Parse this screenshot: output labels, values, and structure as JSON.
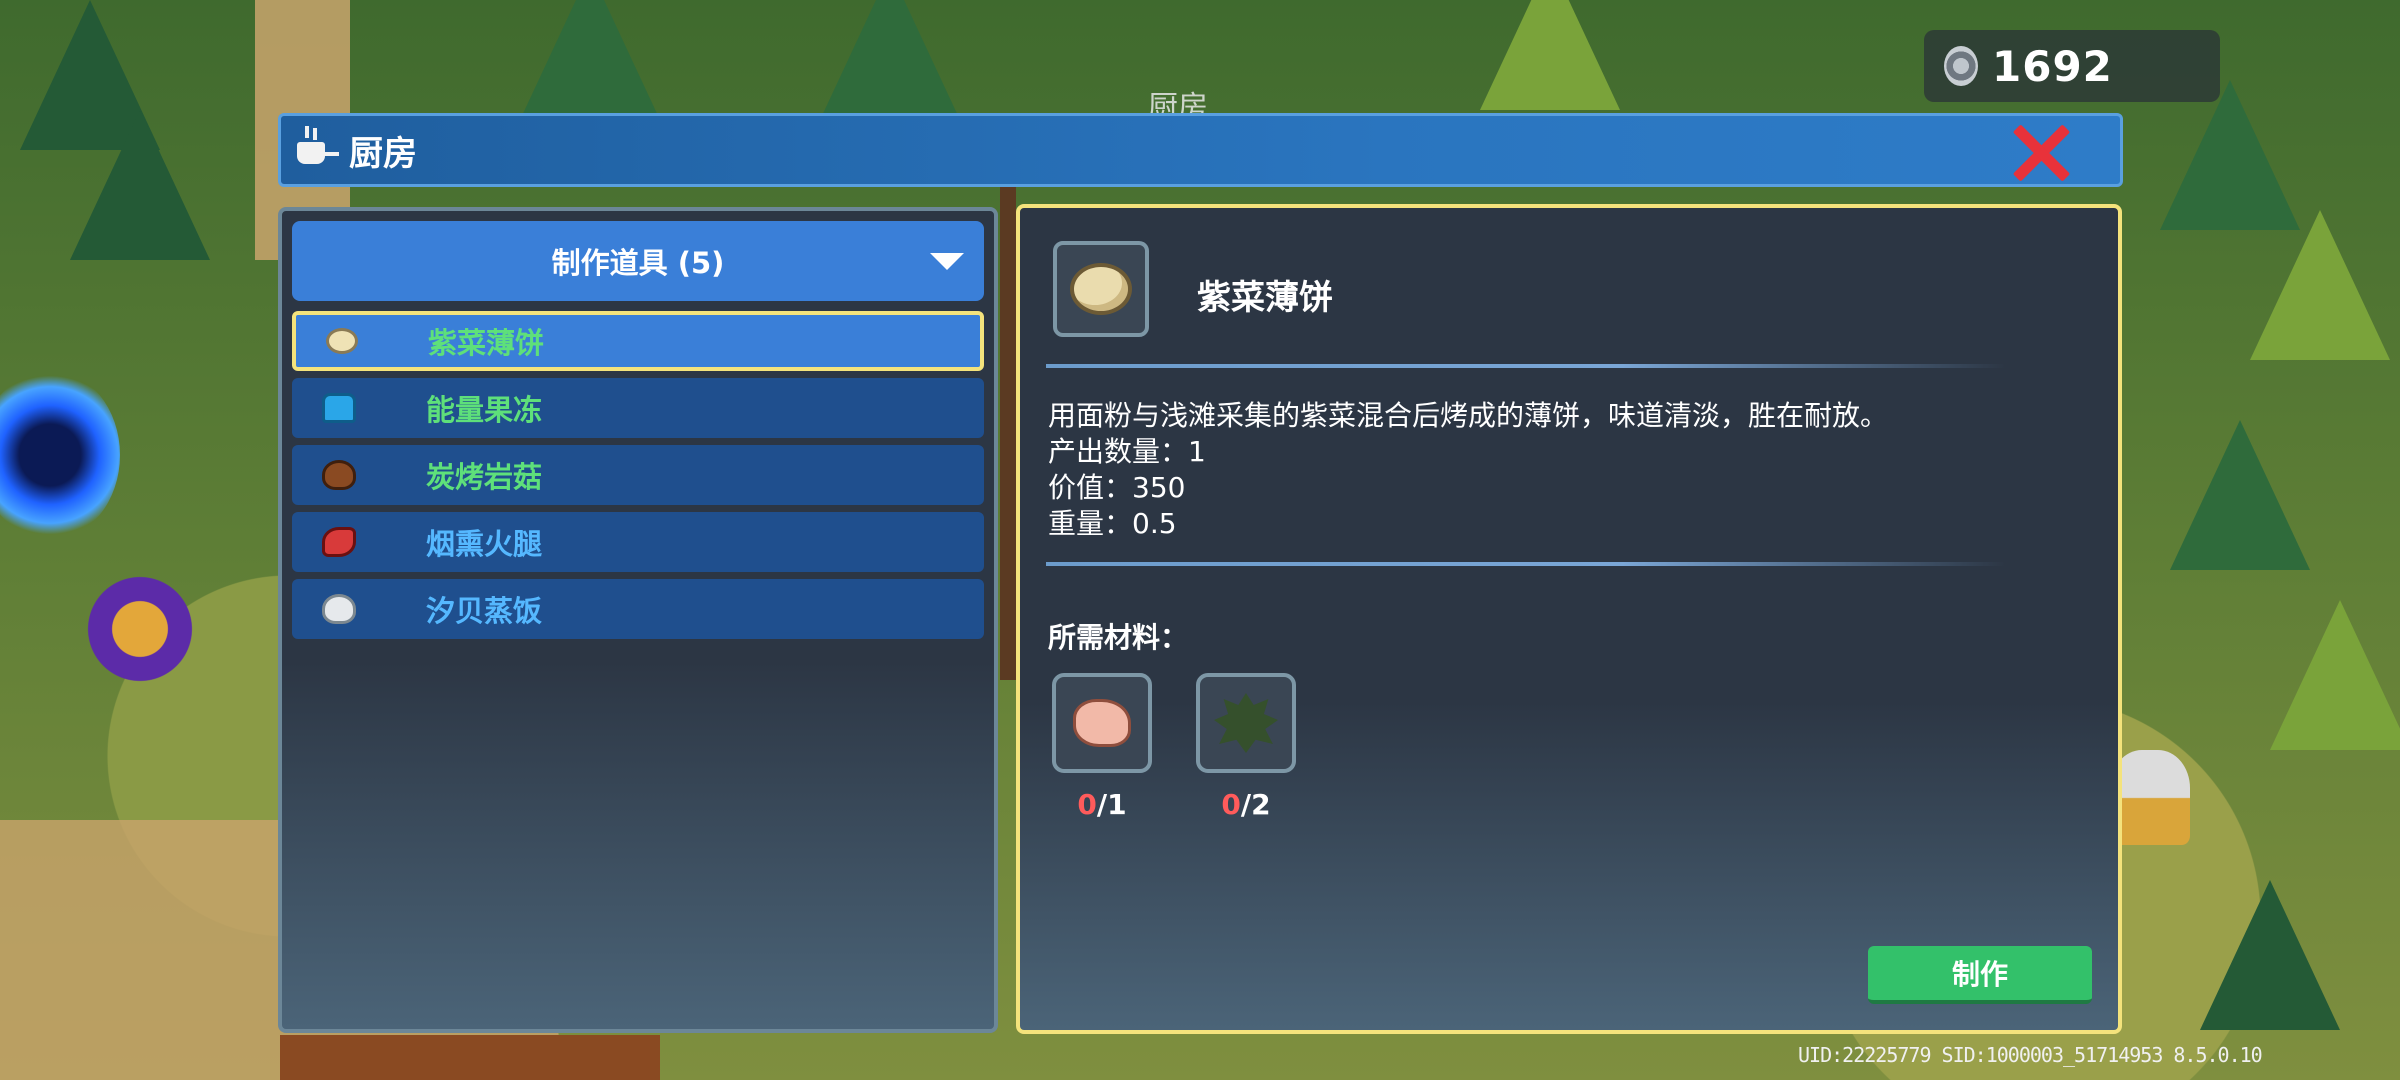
{
  "currency": {
    "icon": "coin-icon",
    "amount": "1692"
  },
  "background_label": "厨房",
  "window": {
    "icon": "cooking-pot-icon",
    "title": "厨房",
    "close_icon": "close-x-icon"
  },
  "category": {
    "label": "制作道具 (5)",
    "caret_icon": "triangle-down-icon"
  },
  "recipes": [
    {
      "name": "紫菜薄饼",
      "icon": "flatbread-icon",
      "selected": true,
      "color": "#5ee07a"
    },
    {
      "name": "能量果冻",
      "icon": "jelly-icon",
      "selected": false,
      "color": "#5ee07a"
    },
    {
      "name": "炭烤岩菇",
      "icon": "mushroom-icon",
      "selected": false,
      "color": "#5ee07a"
    },
    {
      "name": "烟熏火腿",
      "icon": "ham-icon",
      "selected": false,
      "color": "#55b8ff"
    },
    {
      "name": "汐贝蒸饭",
      "icon": "rice-icon",
      "selected": false,
      "color": "#55b8ff"
    }
  ],
  "detail": {
    "name": "紫菜薄饼",
    "icon": "flatbread-icon",
    "description": "用面粉与浅滩采集的紫菜混合后烤成的薄饼，味道清淡，胜在耐放。",
    "output_line": "产出数量：1",
    "value_line": "价值：350",
    "weight_line": "重量：0.5",
    "materials_title": "所需材料：",
    "materials": [
      {
        "icon": "flour-icon",
        "have": "0",
        "need": "/1"
      },
      {
        "icon": "seaweed-icon",
        "have": "0",
        "need": "/2"
      }
    ],
    "craft_label": "制作"
  },
  "footer": {
    "uid_text": "UID:22225779 SID:1000003_51714953 8.5.0.10"
  },
  "colors": {
    "accent_blue": "#3a7fd8",
    "selected_border": "#f4e37c",
    "craft_green": "#33c16a",
    "missing_red": "#ff5b5b"
  }
}
